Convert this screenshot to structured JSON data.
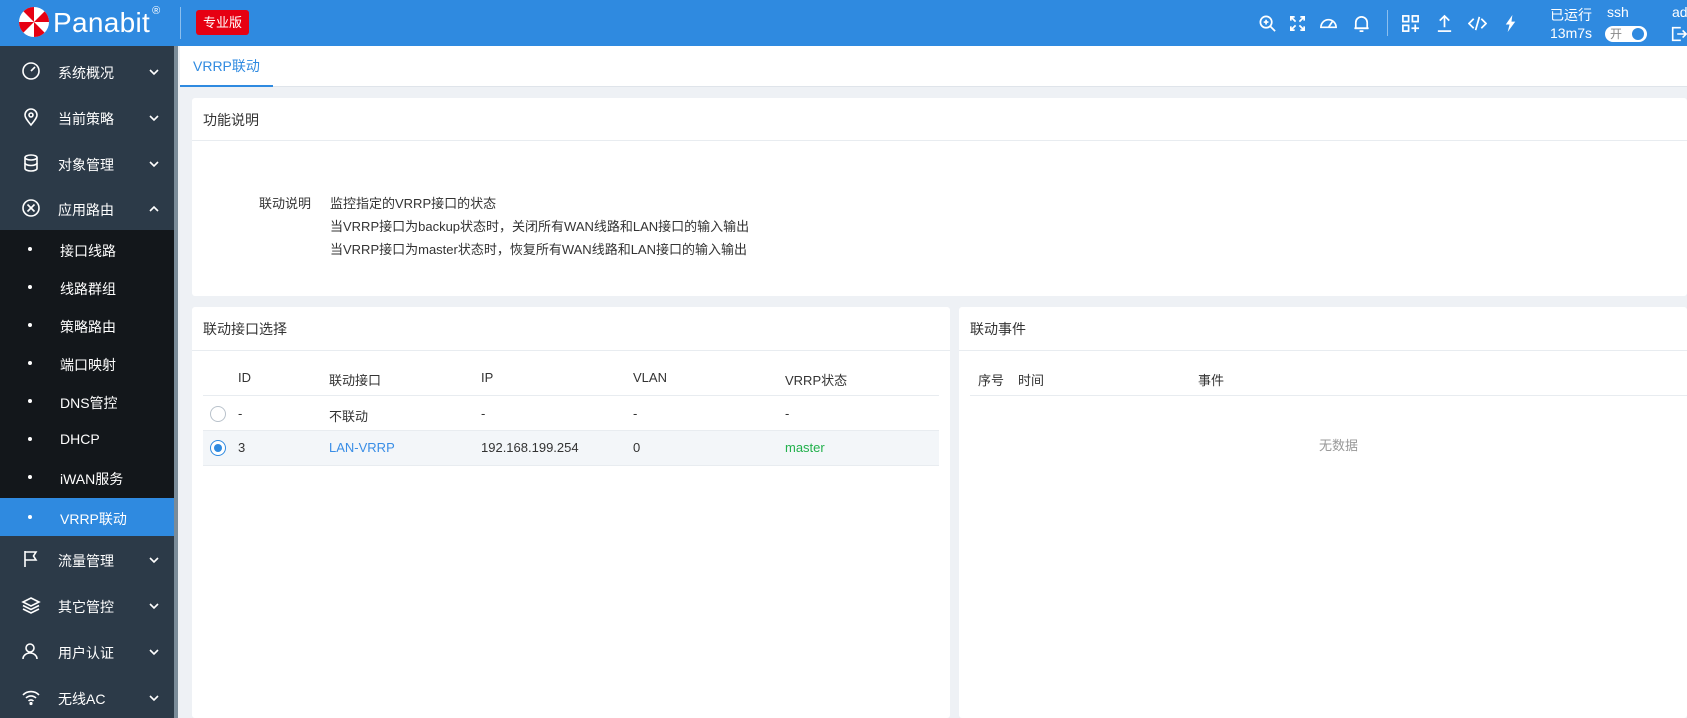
{
  "header": {
    "brand": "Panabit",
    "reg_mark": "®",
    "edition": "专业版",
    "uptime_label": "已运行",
    "uptime_value": "13m7s",
    "ssh_label": "ssh",
    "ssh_toggle_text": "开",
    "user": "admin",
    "icons": [
      "search-zoom-icon",
      "fullscreen-icon",
      "dashboard-icon",
      "bell-icon",
      "apps-icon",
      "upload-icon",
      "code-icon",
      "lightning-icon",
      "logout-icon"
    ]
  },
  "sidebar": {
    "items": [
      {
        "label": "系统概况",
        "icon": "gauge-icon"
      },
      {
        "label": "当前策略",
        "icon": "location-pin-icon"
      },
      {
        "label": "对象管理",
        "icon": "database-icon"
      },
      {
        "label": "应用路由",
        "icon": "cross-circle-icon",
        "expanded": true
      },
      {
        "label": "流量管理",
        "icon": "flag-icon"
      },
      {
        "label": "其它管控",
        "icon": "layers-icon"
      },
      {
        "label": "用户认证",
        "icon": "user-icon"
      },
      {
        "label": "无线AC",
        "icon": "wifi-icon"
      }
    ],
    "subitems": [
      "接口线路",
      "线路群组",
      "策略路由",
      "端口映射",
      "DNS管控",
      "DHCP",
      "iWAN服务",
      "VRRP联动"
    ],
    "active_sub": "VRRP联动"
  },
  "tab": {
    "label": "VRRP联动"
  },
  "func_panel": {
    "title": "功能说明",
    "label": "联动说明",
    "lines": [
      "监控指定的VRRP接口的状态",
      "当VRRP接口为backup状态时，关闭所有WAN线路和LAN接口的输入输出",
      "当VRRP接口为master状态时，恢复所有WAN线路和LAN接口的输入输出"
    ]
  },
  "iface_panel": {
    "title": "联动接口选择",
    "columns": [
      "ID",
      "联动接口",
      "IP",
      "VLAN",
      "VRRP状态"
    ],
    "rows": [
      {
        "id": "-",
        "iface": "不联动",
        "ip": "-",
        "vlan": "-",
        "status": "-",
        "selected": false
      },
      {
        "id": "3",
        "iface": "LAN-VRRP",
        "ip": "192.168.199.254",
        "vlan": "0",
        "status": "master",
        "selected": true
      }
    ]
  },
  "events_panel": {
    "title": "联动事件",
    "columns": [
      "序号",
      "时间",
      "事件"
    ],
    "empty_text": "无数据"
  },
  "colors": {
    "primary": "#2f8ae0",
    "sidebar": "#2c3a48",
    "submenu": "#13171b",
    "edition_badge": "#e60012",
    "master": "#22b14c"
  }
}
